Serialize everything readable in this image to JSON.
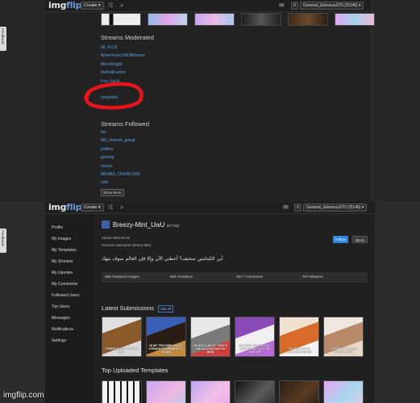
{
  "brand": {
    "logo_main": "img",
    "logo_accent": "flip",
    "accent_color": "#5aa0e8",
    "circle_color": "#e8141c"
  },
  "topbar": {
    "create_label": "Create ▾",
    "shuffle_icon": "shuffle-icon",
    "search_icon": "search-icon",
    "mail_icon": "mail-icon",
    "notification_count": "0",
    "user_top": "General_Grievous270 (15146) ▾",
    "user_bottom": "General_Grievous270 (15146) ▾"
  },
  "feedback_label": "Feedback",
  "top_screen": {
    "streams_moderated_title": "Streams Moderated",
    "streams_moderated": [
      "nfl_41L0l",
      "WhenYourChillOfMemes",
      "MoonKnight",
      "NoAntiFurries",
      "Fun_Facts",
      "zoophiles"
    ],
    "streams_followed_title": "Streams Followed",
    "streams_followed": [
      "fun",
      "MS_maman_group",
      "politics",
      "gaming",
      "repost",
      "MEMES_OVERLOAD",
      "cats"
    ],
    "show_more_label": "Show More"
  },
  "bottom_screen": {
    "nav_items": [
      "Profile",
      "My Images",
      "My Templates",
      "My Streams",
      "My Upvotes",
      "My Comments",
      "Followed Users",
      "Top Users",
      "Messages",
      "Notifications",
      "Settings"
    ],
    "profile": {
      "username": "Breezy-Mint_UwU",
      "points": "(87745)",
      "joined": "Joined 2022-02-20",
      "previous": "Previous username: Breezy-Mint",
      "follow_label": "Follow",
      "block_label": "Block",
      "bio": "أين الكيتامين سحيف؟ أعطني الآن وإلا فإن العالم سوف ينهك"
    },
    "stats": {
      "featured": "365 Featured Images",
      "creations": "925 Creations",
      "comments": "4577 Comments",
      "followers": "79 Followers"
    },
    "latest_submissions_title": "Latest Submissions",
    "see_all_label": "See All",
    "submission_captions": [
      "THERE IS NOT A WOLF LEA..",
      "HI MY TEACHER IS NOT STRAIGHTFORWARD TO LEARN",
      "I'M NOT A WOLF THAT'S AN ACCUSATION I'M NEW",
      "I'M VERY MUCH A CAT BUT I'M NOT OUT OF LINE YET",
      "OH YES THAT'S GLORIOUS FURRY",
      "THE WOLF IS STILL PATROLLING"
    ],
    "top_templates_title": "Top Uploaded Templates"
  },
  "watermark": "imgflip.com"
}
